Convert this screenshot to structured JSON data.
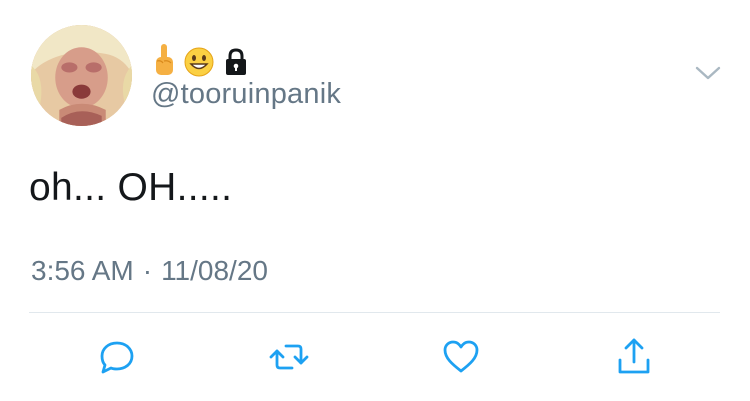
{
  "tweet": {
    "name_emojis": [
      "middle-finger-emoji",
      "grinning-face-emoji"
    ],
    "protected_icon": "lock-icon",
    "handle": "@tooruinpanik",
    "text": "oh... OH.....",
    "time": "3:56 AM",
    "separator": "·",
    "date": "11/08/20"
  },
  "actions": {
    "reply_icon": "reply-icon",
    "retweet_icon": "retweet-icon",
    "like_icon": "heart-icon",
    "share_icon": "share-icon"
  },
  "colors": {
    "text": "#14171a",
    "secondary": "#657786",
    "divider": "#e1e8ed",
    "action_icon": "#1da1f2"
  }
}
